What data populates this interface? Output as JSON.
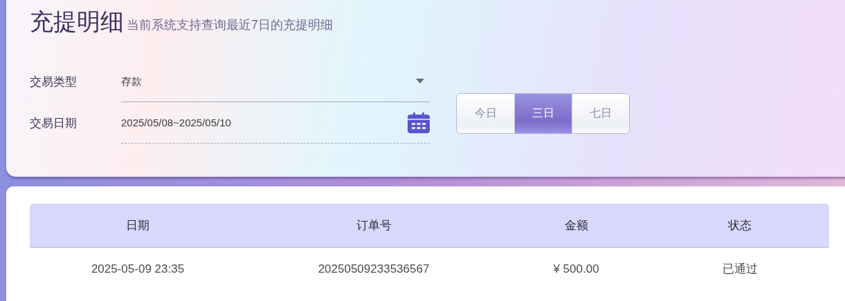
{
  "header": {
    "title": "充提明细",
    "subtitle": "当前系统支持查询最近7日的充提明细"
  },
  "filters": [
    {
      "kind": "select",
      "label": "交易类型",
      "value": "存款"
    },
    {
      "kind": "date",
      "label": "交易日期",
      "value": "2025/05/08~2025/05/10"
    }
  ],
  "ranges": [
    {
      "label": "今日",
      "selected": false
    },
    {
      "label": "三日",
      "selected": true
    },
    {
      "label": "七日",
      "selected": false
    }
  ],
  "table": {
    "columns": [
      "日期",
      "订单号",
      "金额",
      "状态"
    ],
    "rows": [
      [
        "2025-05-09 23:35",
        "20250509233536567",
        "¥ 500.00",
        "已通过"
      ]
    ]
  }
}
